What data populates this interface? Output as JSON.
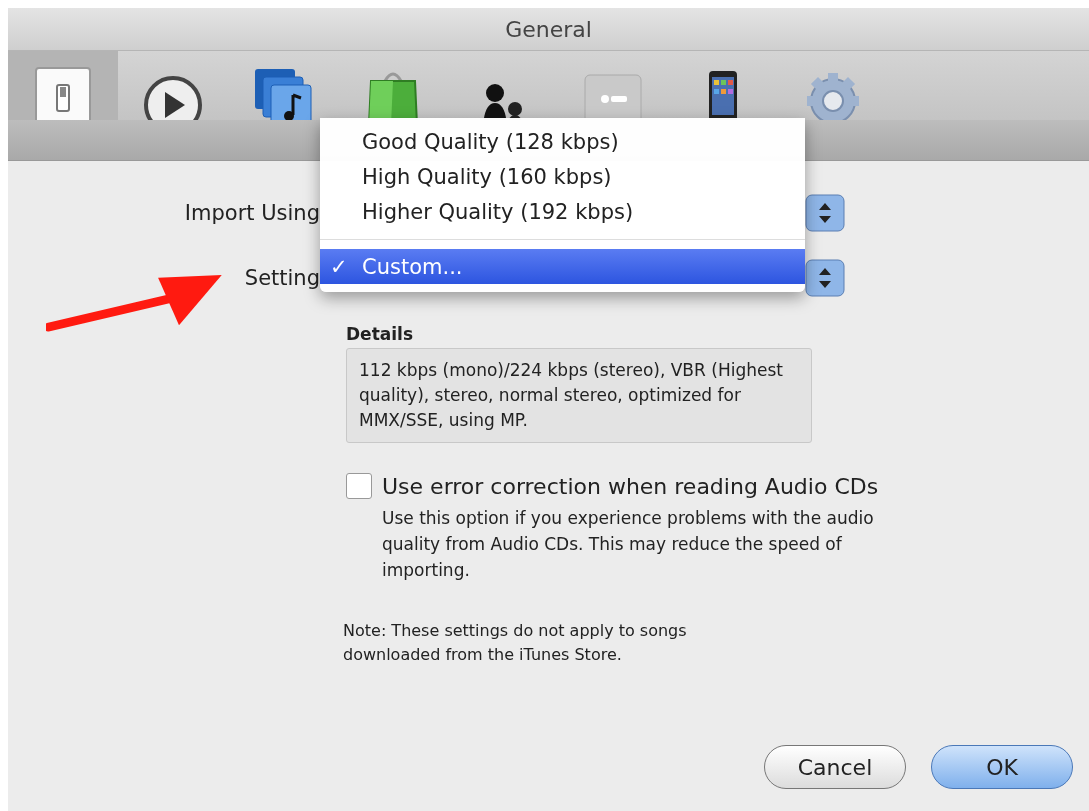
{
  "window": {
    "title": "General"
  },
  "toolbar": [
    {
      "kind": "general",
      "selected": true
    },
    {
      "kind": "playback",
      "selected": false
    },
    {
      "kind": "sharing",
      "selected": false
    },
    {
      "kind": "store",
      "selected": false
    },
    {
      "kind": "parental",
      "selected": false
    },
    {
      "kind": "tv",
      "selected": false
    },
    {
      "kind": "phone",
      "selected": false
    },
    {
      "kind": "gear",
      "selected": false
    }
  ],
  "form": {
    "import_using_label": "Import Using",
    "setting_label": "Setting"
  },
  "menu": [
    {
      "kind": "option",
      "label": "Good Quality (128 kbps)",
      "selected": false
    },
    {
      "kind": "option",
      "label": "High Quality (160 kbps)",
      "selected": false
    },
    {
      "kind": "option",
      "label": "Higher Quality (192 kbps)",
      "selected": false
    },
    {
      "kind": "separator"
    },
    {
      "kind": "option",
      "label": "Custom...",
      "selected": true,
      "check": "✓"
    }
  ],
  "details": {
    "label": "Details",
    "text": "112 kbps (mono)/224 kbps (stereo), VBR (Highest quality), stereo, normal stereo, optimized for MMX/SSE, using MP."
  },
  "error_correction": {
    "label": "Use error correction when reading Audio CDs",
    "checked": false,
    "description": "Use this option if you experience problems with the audio quality from Audio CDs. This may reduce the speed of importing."
  },
  "note": "Note: These settings do not apply to songs downloaded from the iTunes Store.",
  "buttons": [
    {
      "label": "Cancel",
      "default": false
    },
    {
      "label": "OK",
      "default": true
    }
  ]
}
